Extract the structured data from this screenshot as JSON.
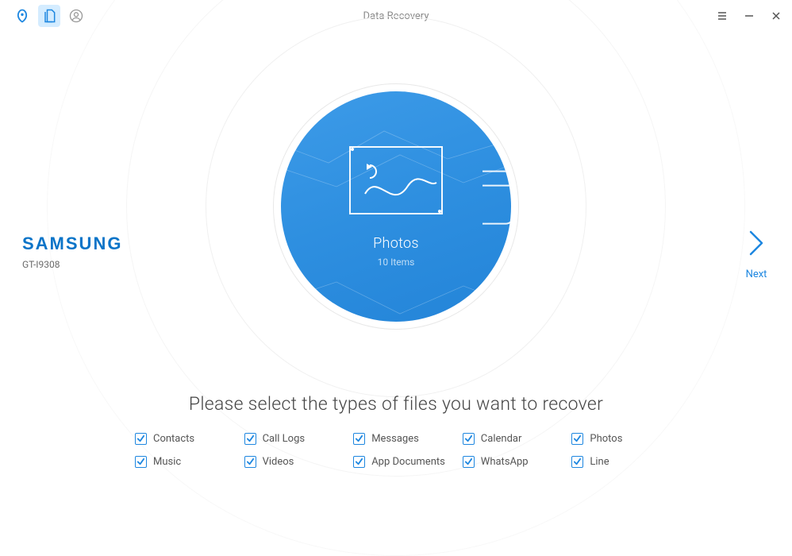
{
  "window": {
    "title": "Data Recovery"
  },
  "device": {
    "brand": "SAMSUNG",
    "model": "GT-I9308"
  },
  "center": {
    "label": "Photos",
    "sub": "10 Items"
  },
  "next_label": "Next",
  "instruction": "Please select the types of files you want to recover",
  "file_types": {
    "row1": [
      {
        "label": "Contacts",
        "checked": true
      },
      {
        "label": "Call Logs",
        "checked": true
      },
      {
        "label": "Messages",
        "checked": true
      },
      {
        "label": "Calendar",
        "checked": true
      },
      {
        "label": "Photos",
        "checked": true
      }
    ],
    "row2": [
      {
        "label": "Music",
        "checked": true
      },
      {
        "label": "Videos",
        "checked": true
      },
      {
        "label": "App Documents",
        "checked": true
      },
      {
        "label": "WhatsApp",
        "checked": true
      },
      {
        "label": "Line",
        "checked": true
      }
    ]
  }
}
